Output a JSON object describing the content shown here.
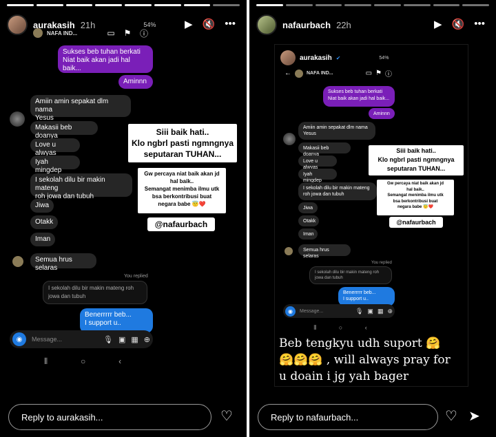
{
  "left": {
    "username": "aurakasih",
    "time": "21h",
    "subheader": "NAFA IND...",
    "statusbar": "54%",
    "chat": {
      "sent1": "Sukses beb tuhan berkati\nNiat baik akan jadi hal baik...",
      "sent2": "Aminnn",
      "recv": [
        "Amiin amin sepakat dlm nama\nYesus",
        "Makasii beb doanya",
        "Love u alwyas",
        "Iyah mingdep",
        "I sekolah dilu bir makin mateng\nroh jowa dan tubuh",
        "Jiwa",
        "Otakk",
        "Iman",
        "Semua hrus selaras"
      ],
      "you_replied": "You replied",
      "replied_quote": "I sekolah dilu bir makin mateng roh\njowa dan tubuh",
      "blue_reply": "Benerrrrr beb...\nI support u..",
      "message_placeholder": "Message..."
    },
    "sticker_main": "Siii baik hati..\nKlo ngbrl  pasti ngmngnya\nseputaran TUHAN...",
    "sticker_sub": "Gw percaya niat baik akan jd\nhal baik..\nSemangat menimba ilmu utk\nbsa berkontribusi buat\nnegara babe 😇❤️",
    "mention": "@nafaurbach",
    "reply_placeholder": "Reply to aurakasih..."
  },
  "right": {
    "username": "nafaurbach",
    "time": "22h",
    "inner_username": "aurakasih",
    "inner_subheader": "NAFA IND...",
    "statusbar": "54%",
    "chat": {
      "sent1": "Sukses beb tuhan berkati\nNiat baik akan jadi hal baik...",
      "sent2": "Aminnn",
      "recv": [
        "Amiin amin sepakat dlm nama\nYesus",
        "Makasii beb doanya",
        "Love u alwyas",
        "Iyah mingdep",
        "I sekolah dilu bir makin mateng\nroh jowa dan tubuh",
        "Jiwa",
        "Otakk",
        "Iman",
        "Semua hrus selaras"
      ],
      "you_replied": "You replied",
      "replied_quote": "I sekolah dilu bir makin mateng roh\njowa dan tubuh",
      "blue_reply": "Benerrrrr beb...\nI support u..",
      "message_placeholder": "Message..."
    },
    "sticker_main": "Siii baik hati..\nKlo ngbrl  pasti ngmngnya\nseputaran TUHAN...",
    "sticker_sub": "Gw percaya niat baik akan jd\nhal baik..\nSemangat menimba ilmu utk\nbsa berkontribusi buat\nnegara babe 😇❤️",
    "mention": "@nafaurbach",
    "caption": "Beb tengkyu udh suport 🤗\n🤗🤗🤗 , will always pray for\nu doain i jg yah bager",
    "reply_placeholder": "Reply to nafaurbach..."
  },
  "icons": {
    "play": "play-icon",
    "mute": "mute-icon",
    "more": "more-icon",
    "heart": "heart-icon",
    "send": "send-icon",
    "camera": "camera-icon",
    "video": "video-icon",
    "flag": "flag-icon",
    "info": "info-icon"
  },
  "colors": {
    "sent_bubble": "#7a1fb8",
    "blue_bubble": "#1f7ae0",
    "received_bubble": "#262626"
  }
}
